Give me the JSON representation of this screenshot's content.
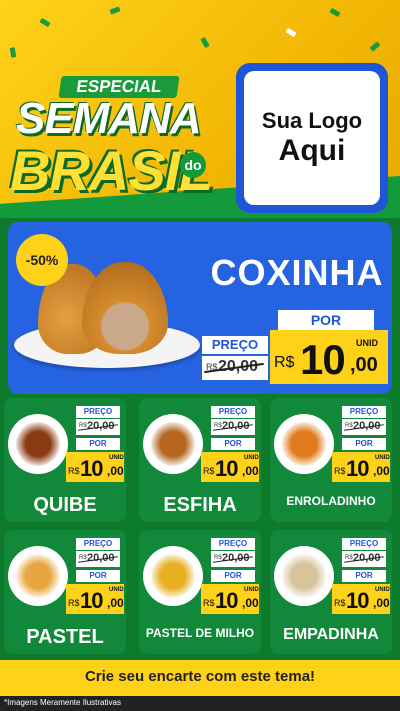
{
  "header": {
    "especial": "ESPECIAL",
    "semana": "SEMANA",
    "do": "do",
    "brasil": "BRASIL",
    "logo_line1": "Sua Logo",
    "logo_line2": "Aqui"
  },
  "hero": {
    "discount": "-50%",
    "name": "COXINHA",
    "preco_label": "PREÇO",
    "old_currency": "R$",
    "old_price": "20,00",
    "por_label": "POR",
    "new_currency": "R$",
    "new_int": "10",
    "new_dec": ",00",
    "unid": "UNID"
  },
  "products": [
    {
      "name": "QUIBE",
      "preco_label": "PREÇO",
      "old_currency": "R$",
      "old_price": "20,00",
      "por_label": "POR",
      "new_currency": "R$",
      "new_int": "10",
      "new_dec": ",00",
      "unid": "UNID"
    },
    {
      "name": "ESFIHA",
      "preco_label": "PREÇO",
      "old_currency": "R$",
      "old_price": "20,00",
      "por_label": "POR",
      "new_currency": "R$",
      "new_int": "10",
      "new_dec": ",00",
      "unid": "UNID"
    },
    {
      "name": "ENROLADINHO",
      "preco_label": "PREÇO",
      "old_currency": "R$",
      "old_price": "20,00",
      "por_label": "POR",
      "new_currency": "R$",
      "new_int": "10",
      "new_dec": ",00",
      "unid": "UNID"
    },
    {
      "name": "PASTEL",
      "preco_label": "PREÇO",
      "old_currency": "R$",
      "old_price": "20,00",
      "por_label": "POR",
      "new_currency": "R$",
      "new_int": "10",
      "new_dec": ",00",
      "unid": "UNID"
    },
    {
      "name": "PASTEL DE MILHO",
      "preco_label": "PREÇO",
      "old_currency": "R$",
      "old_price": "20,00",
      "por_label": "POR",
      "new_currency": "R$",
      "new_int": "10",
      "new_dec": ",00",
      "unid": "UNID"
    },
    {
      "name": "EMPADINHA",
      "preco_label": "PREÇO",
      "old_currency": "R$",
      "old_price": "20,00",
      "por_label": "POR",
      "new_currency": "R$",
      "new_int": "10",
      "new_dec": ",00",
      "unid": "UNID"
    }
  ],
  "footer": {
    "cta": "Crie seu encarte com este tema!",
    "disclaimer": "*Imagens Meramente Ilustrativas"
  },
  "colors": {
    "green": "#12893a",
    "yellow": "#ffd21a",
    "blue": "#2563e0"
  }
}
